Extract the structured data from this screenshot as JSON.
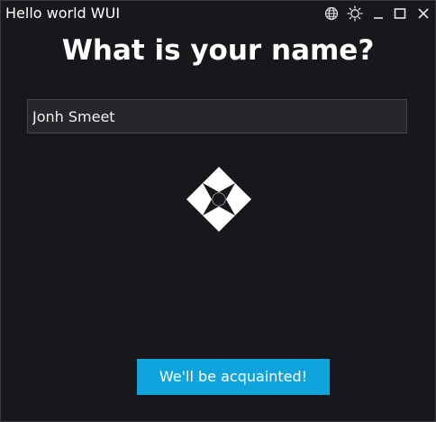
{
  "window": {
    "title": "Hello world WUI",
    "controls": [
      {
        "icon": "globe-icon"
      },
      {
        "icon": "sun-icon"
      },
      {
        "icon": "minimize-icon"
      },
      {
        "icon": "maximize-icon"
      },
      {
        "icon": "close-icon"
      }
    ]
  },
  "main": {
    "heading": "What is your name?",
    "name_input": {
      "value": "Jonh Smeet",
      "placeholder": ""
    },
    "logo_icon": "four-petal-diamond-logo",
    "submit_label": "We'll be acquainted!"
  },
  "colors": {
    "background": "#17181b",
    "input_background": "#26272b",
    "accent": "#0ea3dc",
    "text": "#ffffff"
  }
}
